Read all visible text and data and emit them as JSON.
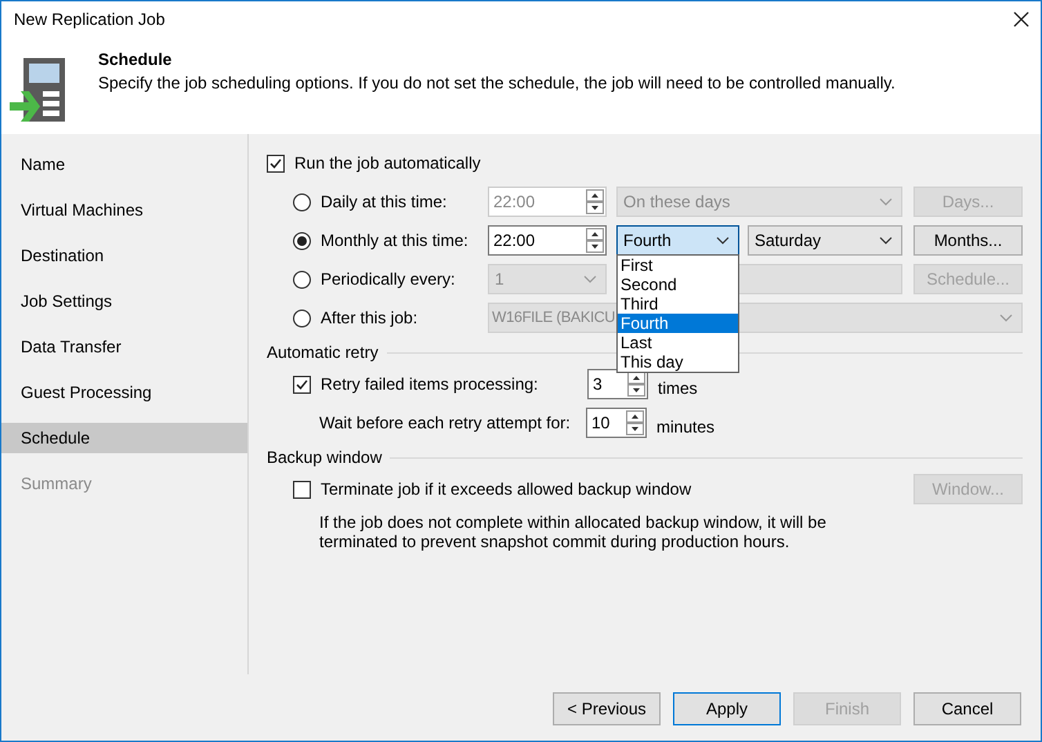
{
  "window": {
    "title": "New Replication Job"
  },
  "header": {
    "title": "Schedule",
    "description": "Specify the job scheduling options. If you do not set the schedule, the job will need to be controlled manually."
  },
  "sidebar": {
    "items": [
      {
        "label": "Name",
        "selected": false,
        "disabled": false
      },
      {
        "label": "Virtual Machines",
        "selected": false,
        "disabled": false
      },
      {
        "label": "Destination",
        "selected": false,
        "disabled": false
      },
      {
        "label": "Job Settings",
        "selected": false,
        "disabled": false
      },
      {
        "label": "Data Transfer",
        "selected": false,
        "disabled": false
      },
      {
        "label": "Guest Processing",
        "selected": false,
        "disabled": false
      },
      {
        "label": "Schedule",
        "selected": true,
        "disabled": false
      },
      {
        "label": "Summary",
        "selected": false,
        "disabled": true
      }
    ]
  },
  "run_automatically": {
    "label": "Run the job automatically",
    "checked": true
  },
  "schedule_options": [
    {
      "kind": "daily",
      "label": "Daily at this time:",
      "selected": false,
      "time": "22:00",
      "combo": "On these days",
      "button": "Days..."
    },
    {
      "kind": "monthly",
      "label": "Monthly at this time:",
      "selected": true,
      "time": "22:00",
      "combo": "Fourth",
      "combo2": "Saturday",
      "button": "Months..."
    },
    {
      "kind": "periodic",
      "label": "Periodically every:",
      "selected": false,
      "combo": "1",
      "button": "Schedule..."
    },
    {
      "kind": "after",
      "label": "After this job:",
      "selected": false,
      "combo": "W16FILE (BAKICU"
    }
  ],
  "dropdown": {
    "options": [
      {
        "label": "First",
        "selected": false
      },
      {
        "label": "Second",
        "selected": false
      },
      {
        "label": "Third",
        "selected": false
      },
      {
        "label": "Fourth",
        "selected": true
      },
      {
        "label": "Last",
        "selected": false
      },
      {
        "label": "This day",
        "selected": false
      }
    ]
  },
  "retry": {
    "section": "Automatic retry",
    "label": "Retry failed items processing:",
    "checked": true,
    "value": "3",
    "unit": "times",
    "wait_label": "Wait before each retry attempt for:",
    "wait_value": "10",
    "wait_unit": "minutes"
  },
  "backup_window": {
    "section": "Backup window",
    "label": "Terminate job if it exceeds allowed backup window",
    "checked": false,
    "button": "Window...",
    "description": "If the job does not complete within allocated backup window, it will be terminated to prevent snapshot commit during production hours."
  },
  "buttons": [
    {
      "label": "< Previous",
      "disabled": false,
      "default": false
    },
    {
      "label": "Apply",
      "disabled": false,
      "default": true
    },
    {
      "label": "Finish",
      "disabled": true,
      "default": false
    },
    {
      "label": "Cancel",
      "disabled": false,
      "default": false
    }
  ]
}
